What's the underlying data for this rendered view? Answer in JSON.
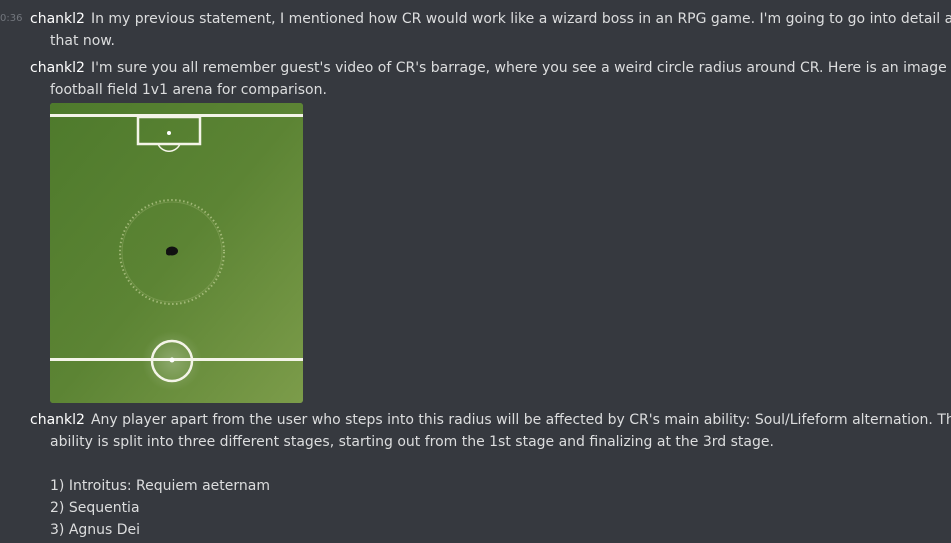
{
  "messages": [
    {
      "timestamp": "0:36",
      "author": "chankl2",
      "lines": [
        "In my previous statement, I mentioned how CR would work like a wizard boss in an RPG game. I'm going to go into detail about",
        "that now."
      ]
    },
    {
      "author": "chankl2",
      "lines": [
        "I'm sure you all remember guest's video of CR's barrage, where you see a weird circle radius around CR. Here is an image of the",
        "football field 1v1 arena for comparison."
      ]
    },
    {
      "author": "chankl2",
      "lines": [
        "Any player apart from the user who steps into this radius will be affected by CR's main ability: Soul/Lifeform alternation. This",
        "ability is split into three different stages, starting out from the 1st stage and finalizing at the 3rd stage."
      ],
      "list": [
        "1) Introitus: Requiem aeternam",
        "2) Sequentia",
        "3) Agnus Dei"
      ]
    }
  ],
  "attachment": {
    "kind": "image",
    "description": "football-field-arena",
    "colors": {
      "grass_dark": "#4e7a2c",
      "grass_light": "#7c9c4a",
      "lines": "#f4f4e8"
    }
  }
}
